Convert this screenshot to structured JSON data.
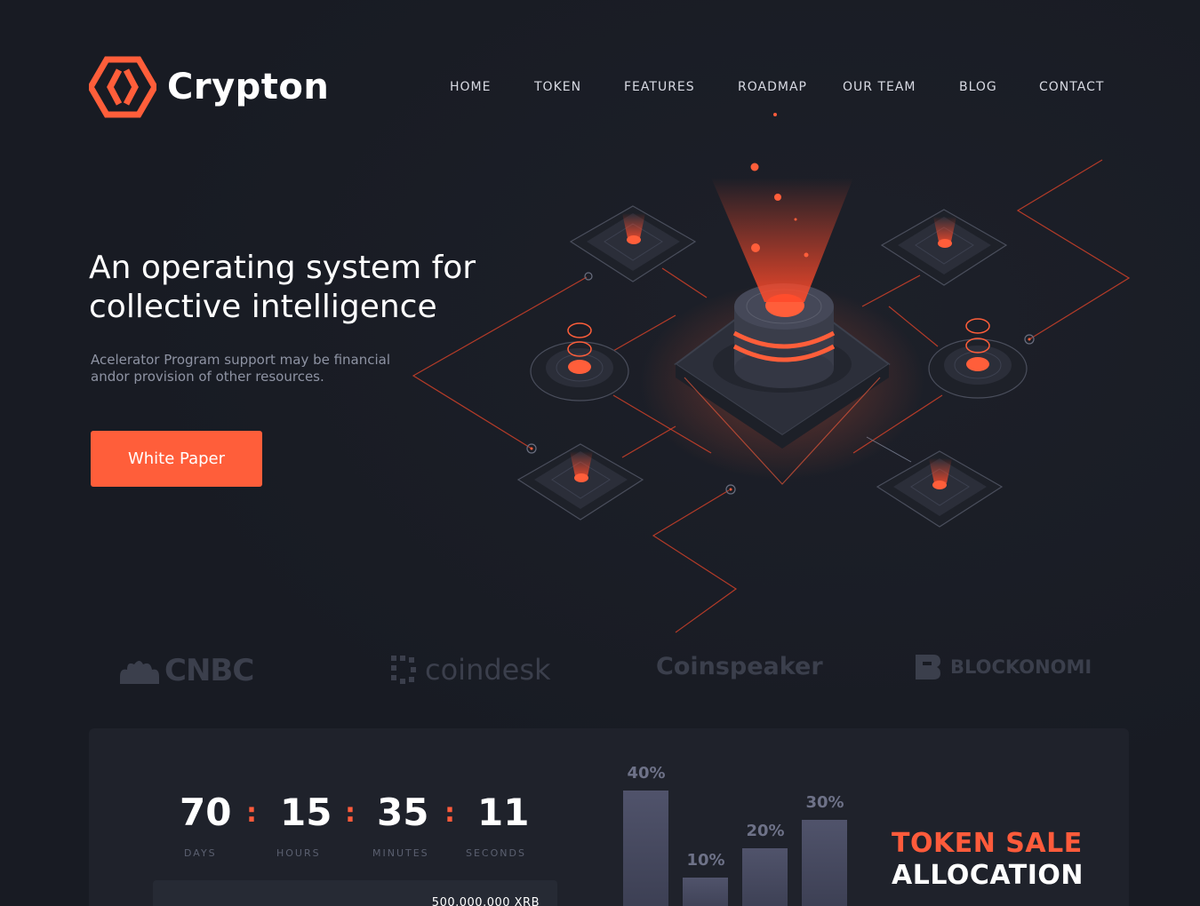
{
  "brand": {
    "name": "Crypton",
    "accent": "#ff5e3a",
    "background": "#181b23"
  },
  "nav": {
    "items": [
      {
        "label": "HOME"
      },
      {
        "label": "TOKEN"
      },
      {
        "label": "FEATURES"
      },
      {
        "label": "ROADMAP",
        "active": true
      },
      {
        "label": "OUR TEAM"
      },
      {
        "label": "BLOG"
      },
      {
        "label": "CONTACT"
      }
    ]
  },
  "hero": {
    "title": "An operating system for collective intelligence",
    "subtitle": "Acelerator Program support may be financial andor provision of other resources.",
    "cta_label": "White Paper"
  },
  "partners": [
    {
      "name": "CNBC",
      "icon": "peacock-icon"
    },
    {
      "name": "coindesk",
      "icon": "coindesk-icon"
    },
    {
      "name": "Coinspeaker",
      "icon": "none"
    },
    {
      "name": "BLOCKONOMI",
      "icon": "blockonomi-icon"
    }
  ],
  "countdown": {
    "days": {
      "value": "70",
      "label": "DAYS"
    },
    "hours": {
      "value": "15",
      "label": "HOURS"
    },
    "minutes": {
      "value": "35",
      "label": "MINUTES"
    },
    "seconds": {
      "value": "11",
      "label": "SECONDS"
    },
    "separator": ":"
  },
  "supply": {
    "text": "500,000,000 XRB"
  },
  "allocation": {
    "title_line1": "TOKEN SALE",
    "title_line2": "ALLOCATION"
  },
  "chart_data": {
    "type": "bar",
    "values": [
      40,
      10,
      20,
      30
    ],
    "labels": [
      "40%",
      "10%",
      "20%",
      "30%"
    ],
    "ylim": [
      0,
      40
    ]
  }
}
